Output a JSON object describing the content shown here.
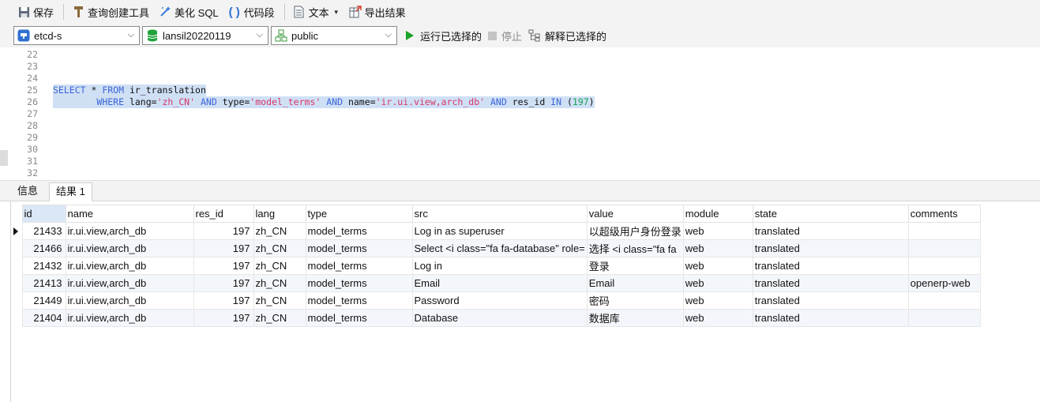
{
  "toolbar": {
    "save": "保存",
    "query_builder": "查询创建工具",
    "beautify": "美化 SQL",
    "snippet": "代码段",
    "text": "文本",
    "export": "导出结果"
  },
  "selectors": {
    "connection": "etcd-s",
    "database": "lansil20220119",
    "schema": "public"
  },
  "actions": {
    "run": "运行已选择的",
    "stop": "停止",
    "explain": "解释已选择的"
  },
  "editor": {
    "line_numbers": [
      "22",
      "23",
      "24",
      "25",
      "26",
      "27",
      "28",
      "29",
      "30",
      "31",
      "32"
    ],
    "l25": {
      "kw1": "SELECT",
      "t1": " * ",
      "kw2": "FROM",
      "t2": " ir_translation"
    },
    "l26": {
      "indent": "        ",
      "kw1": "WHERE",
      "t1": " lang=",
      "s1": "'zh_CN'",
      "t2": " ",
      "kw2": "AND",
      "t3": " type=",
      "s2": "'model_terms'",
      "t4": " ",
      "kw3": "AND",
      "t5": " name=",
      "s3": "'ir.ui.view,arch_db'",
      "t6": " ",
      "kw4": "AND",
      "t7": " res_id ",
      "kw5": "IN",
      "t8": " (",
      "n1": "197",
      "t9": ")"
    }
  },
  "tabs": {
    "info": "信息",
    "result": "结果 1"
  },
  "grid": {
    "columns": [
      "id",
      "name",
      "res_id",
      "lang",
      "type",
      "src",
      "value",
      "module",
      "state",
      "comments"
    ],
    "rows": [
      [
        "21433",
        "ir.ui.view,arch_db",
        "197",
        "zh_CN",
        "model_terms",
        "Log in as superuser",
        "以超级用户身份登录",
        "web",
        "translated",
        ""
      ],
      [
        "21466",
        "ir.ui.view,arch_db",
        "197",
        "zh_CN",
        "model_terms",
        "Select <i class=\"fa fa-database\" role=",
        "选择 <i class=\"fa fa",
        "web",
        "translated",
        ""
      ],
      [
        "21432",
        "ir.ui.view,arch_db",
        "197",
        "zh_CN",
        "model_terms",
        "Log in",
        "登录",
        "web",
        "translated",
        ""
      ],
      [
        "21413",
        "ir.ui.view,arch_db",
        "197",
        "zh_CN",
        "model_terms",
        "Email",
        "Email",
        "web",
        "translated",
        "openerp-web"
      ],
      [
        "21449",
        "ir.ui.view,arch_db",
        "197",
        "zh_CN",
        "model_terms",
        "Password",
        "密码",
        "web",
        "translated",
        ""
      ],
      [
        "21404",
        "ir.ui.view,arch_db",
        "197",
        "zh_CN",
        "model_terms",
        "Database",
        "数据库",
        "web",
        "translated",
        ""
      ]
    ]
  },
  "colors": {
    "keyword": "#3b63d8",
    "string": "#d8366a",
    "number": "#12a150",
    "selection": "#cfe0f5",
    "run": "#1aa32a"
  },
  "icons": [
    "save-icon",
    "hammer-icon",
    "magic-wand-icon",
    "braces-icon",
    "document-icon",
    "export-icon",
    "connection-icon",
    "database-icon",
    "schema-icon",
    "play-icon",
    "stop-icon",
    "explain-icon"
  ]
}
